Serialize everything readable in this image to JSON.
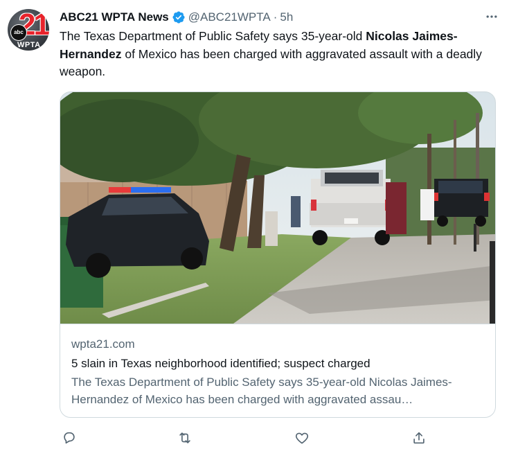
{
  "account": {
    "display_name": "ABC21 WPTA News",
    "handle": "@ABC21WPTA",
    "separator": "·",
    "time": "5h",
    "avatar": {
      "number": "21",
      "network": "abc",
      "callsign": "WPTA"
    },
    "verified": true
  },
  "tweet": {
    "text_before": "The Texas Department of Public Safety says 35-year-old ",
    "text_bold": "Nicolas Jaimes-Hernandez",
    "text_after": " of Mexico has been charged with aggravated assault with a deadly weapon."
  },
  "link_card": {
    "domain": "wpta21.com",
    "title": "5 slain in Texas neighborhood identified; suspect charged",
    "description": "The Texas Department of Public Safety says 35-year-old Nicolas Jaimes-Hernandez of Mexico has been charged with aggravated assau…"
  },
  "actions": {
    "icons": [
      "reply-icon",
      "retweet-icon",
      "like-icon",
      "share-icon"
    ]
  },
  "colors": {
    "text_primary": "#0f1419",
    "text_secondary": "#536471",
    "verified_blue": "#1d9bf0",
    "border": "#cfd9de",
    "brand_red": "#e8232b"
  }
}
